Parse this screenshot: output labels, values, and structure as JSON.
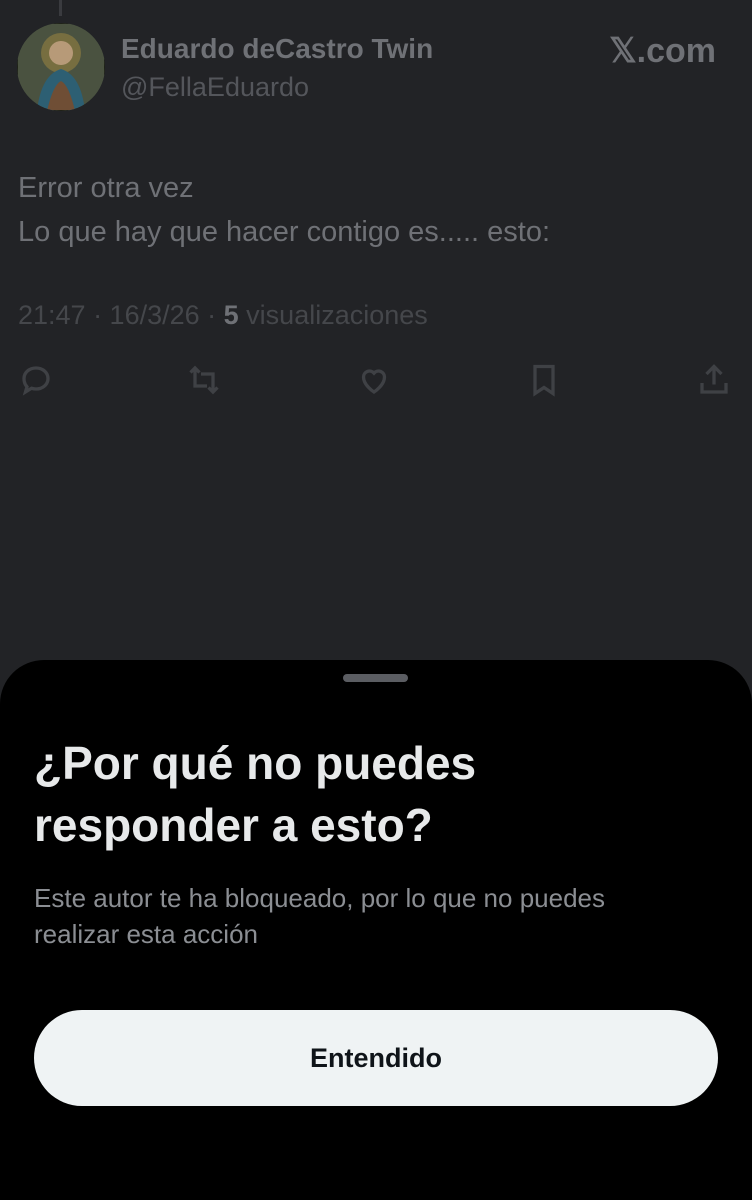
{
  "tweet": {
    "author_name": "Eduardo deCastro Twin",
    "author_handle": "@FellaEduardo",
    "brand": "𝕏.com",
    "text_lines": [
      "Error otra vez",
      "Lo que hay que hacer contigo es..... esto:"
    ],
    "meta_prefix": "21:47 · 16/3/26 · ",
    "views_count": "5",
    "views_label": " visualizaciones",
    "actions": [
      "reply-icon",
      "retweet-icon",
      "like-icon",
      "bookmark-icon",
      "share-icon"
    ]
  },
  "sheet": {
    "title_lines": [
      "¿Por qué no puedes",
      "responder a esto?"
    ],
    "description_lines": [
      "Este autor te ha bloqueado, por lo que no puedes",
      "realizar esta acción"
    ],
    "button_label": "Entendido"
  },
  "colors": {
    "background": "#222326",
    "sheet_background": "#000000",
    "button_background": "#eff3f4",
    "title_text": "#e7e9ea",
    "muted_text": "#8b8e93"
  }
}
